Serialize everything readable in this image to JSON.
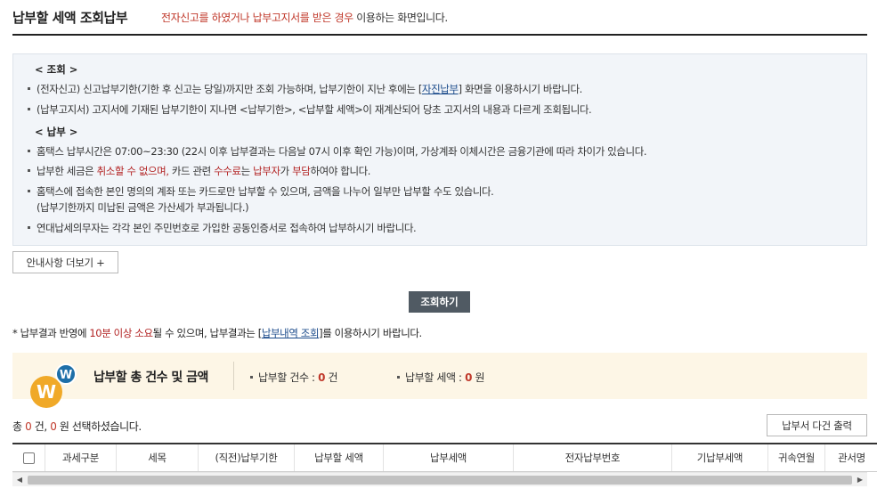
{
  "header": {
    "title": "납부할 세액 조회납부",
    "subtitle_red": "전자신고를 하였거나 납부고지서를 받은 경우",
    "subtitle_rest": " 이용하는 화면입니다."
  },
  "notice": {
    "section1_title": "< 조회 >",
    "s1_line1_a": "(전자신고) 신고납부기한(기한 후 신고는 당일)까지만 조회 가능하며, 납부기한이 지난 후에는 [",
    "s1_line1_link": "자진납부",
    "s1_line1_b": "] 화면을 이용하시기 바랍니다.",
    "s1_line2": "(납부고지서) 고지서에 기재된 납부기한이 지나면 <납부기한>, <납부할 세액>이 재계산되어 당초 고지서의 내용과 다르게 조회됩니다.",
    "section2_title": "< 납부 >",
    "s2_line1": "홈택스 납부시간은 07:00~23:30 (22시 이후 납부결과는 다음날 07시 이후 확인 가능)이며, 가상계좌 이체시간은 금융기관에 따라 차이가 있습니다.",
    "s2_line2_a": "납부한 세금은 ",
    "s2_line2_red1": "취소할 수 없으며,",
    "s2_line2_b": " 카드 관련 ",
    "s2_line2_red2": "수수료",
    "s2_line2_c": "는 ",
    "s2_line2_red3": "납부자",
    "s2_line2_d": "가 ",
    "s2_line2_red4": "부담",
    "s2_line2_e": "하여야 합니다.",
    "s2_line3": "홈택스에 접속한 본인 명의의 계좌 또는 카드로만 납부할 수 있으며, 금액을 나누어 일부만 납부할 수도 있습니다.",
    "s2_line3_sub": "(납부기한까지 미납된 금액은 가산세가 부과됩니다.)",
    "s2_line4": "연대납세의무자는 각각 본인 주민번호로 가입한 공동인증서로 접속하여 납부하시기 바랍니다."
  },
  "buttons": {
    "more": "안내사항 더보기 +",
    "search": "조회하기",
    "print": "납부서 다건 출력"
  },
  "note": {
    "a": "* 납부결과 반영에 ",
    "red": "10분 이상 소요",
    "b": "될 수 있으며, 납부결과는 [",
    "link": "납부내역 조회",
    "c": "]를 이용하시기 바랍니다."
  },
  "summary": {
    "badge_big": "W",
    "badge_small": "W",
    "title": "납부할 총 건수 및 금액",
    "count_label": "납부할 건수 : ",
    "count_value": "0",
    "count_unit": " 건",
    "amount_label": "납부할 세액 : ",
    "amount_value": "0",
    "amount_unit": " 원"
  },
  "selection": {
    "a": "총 ",
    "count": "0",
    "b": " 건, ",
    "amount": "0",
    "c": " 원 선택하셨습니다."
  },
  "table": {
    "columns": [
      "과세구분",
      "세목",
      "(직전)납부기한",
      "납부할 세액",
      "납부세액",
      "전자납부번호",
      "기납부세액",
      "귀속연월",
      "관서명"
    ]
  },
  "scrollbar": {
    "left_arrow": "◀",
    "right_arrow": "▶"
  }
}
